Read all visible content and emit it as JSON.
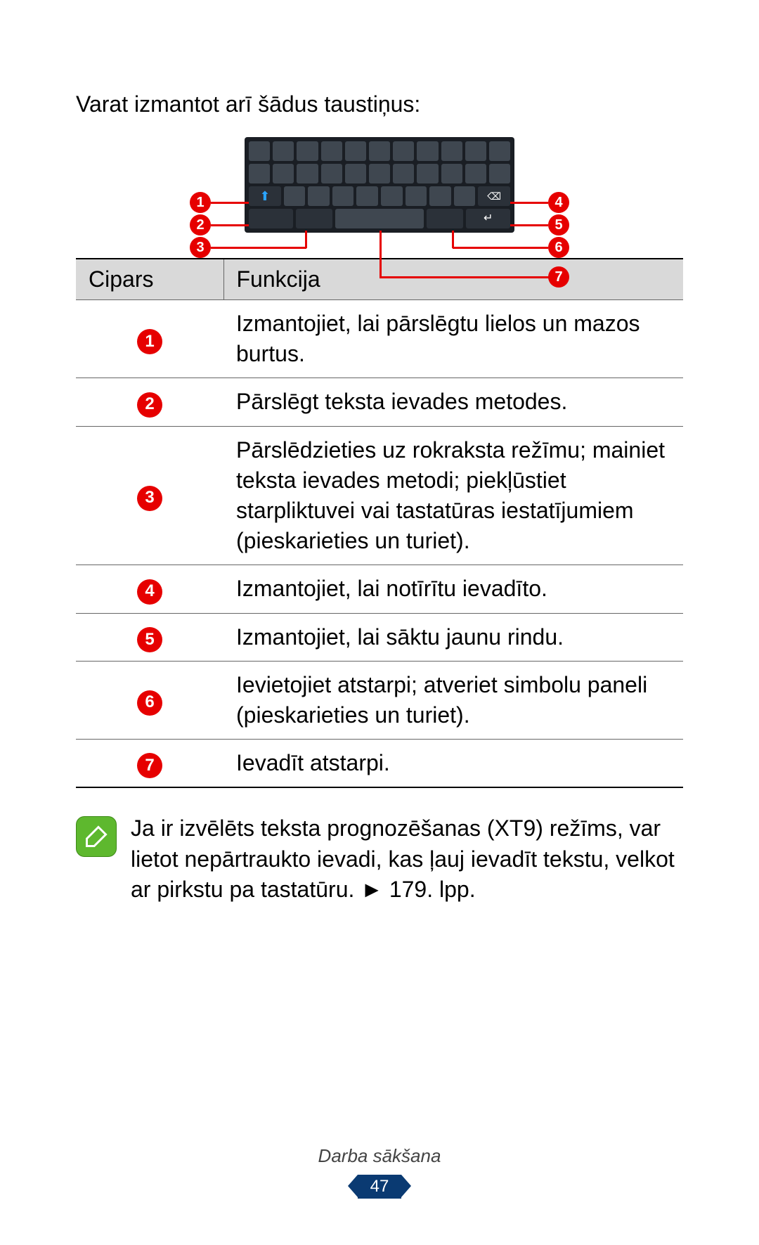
{
  "intro": "Varat izmantot arī šādus taustiņus:",
  "callouts": {
    "c1": "1",
    "c2": "2",
    "c3": "3",
    "c4": "4",
    "c5": "5",
    "c6": "6",
    "c7": "7"
  },
  "table": {
    "h1": "Cipars",
    "h2": "Funkcija",
    "rows": [
      {
        "n": "1",
        "f": "Izmantojiet, lai pārslēgtu lielos un mazos burtus."
      },
      {
        "n": "2",
        "f": "Pārslēgt teksta ievades metodes."
      },
      {
        "n": "3",
        "f": "Pārslēdzieties uz rokraksta režīmu; mainiet teksta ievades metodi; piekļūstiet starpliktuvei vai tastatūras iestatījumiem (pieskarieties un turiet)."
      },
      {
        "n": "4",
        "f": "Izmantojiet, lai notīrītu ievadīto."
      },
      {
        "n": "5",
        "f": "Izmantojiet, lai sāktu jaunu rindu."
      },
      {
        "n": "6",
        "f": "Ievietojiet atstarpi; atveriet simbolu paneli (pieskarieties un turiet)."
      },
      {
        "n": "7",
        "f": "Ievadīt atstarpi."
      }
    ]
  },
  "note": "Ja ir izvēlēts teksta prognozēšanas (XT9) režīms, var lietot nepārtraukto ievadi, kas ļauj ievadīt tekstu, velkot ar pirkstu pa tastatūru. ► 179. lpp.",
  "footer": {
    "label": "Darba sākšana",
    "page": "47"
  }
}
